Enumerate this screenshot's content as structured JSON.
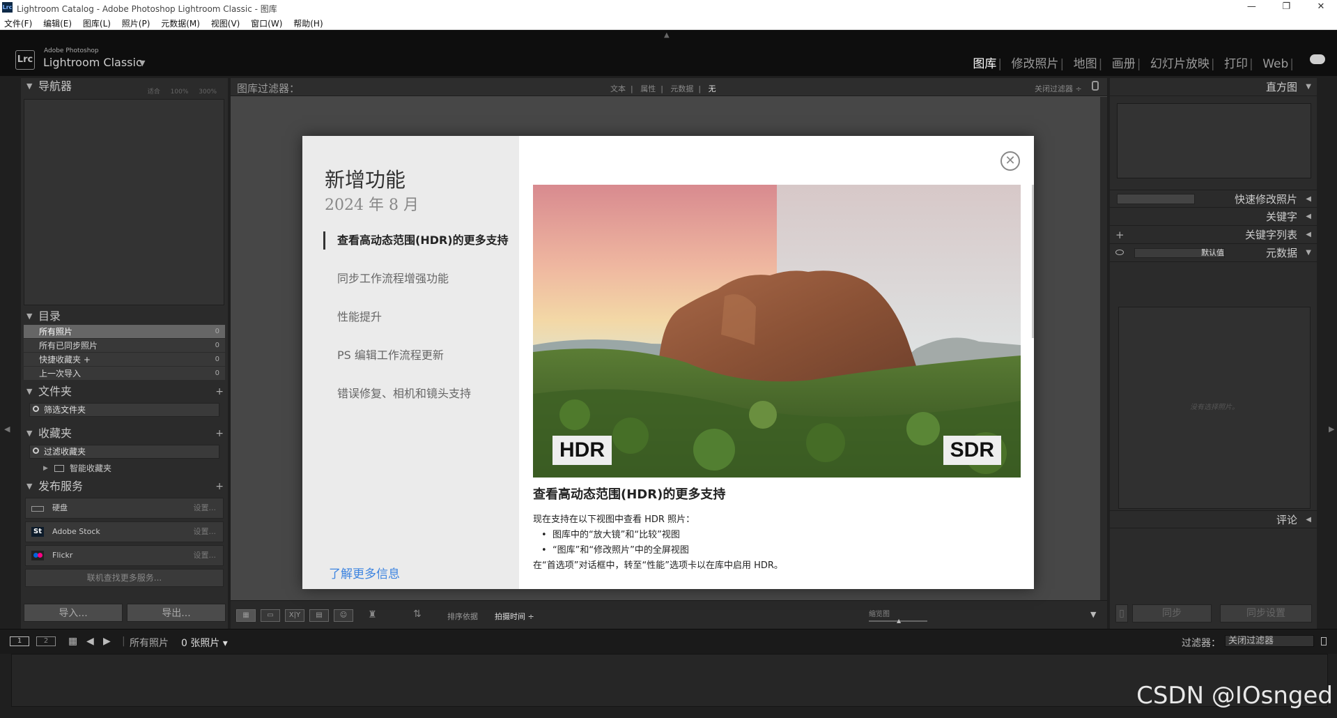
{
  "window": {
    "title": "Lightroom Catalog - Adobe Photoshop Lightroom Classic - 图库",
    "app_icon": "Lrc",
    "min_label": "—",
    "max_label": "❐",
    "close_label": "✕"
  },
  "menu": [
    "文件(F)",
    "编辑(E)",
    "图库(L)",
    "照片(P)",
    "元数据(M)",
    "视图(V)",
    "窗口(W)",
    "帮助(H)"
  ],
  "brand": {
    "line1": "Adobe Photoshop",
    "line2": "Lightroom Classic",
    "logo": "Lrc"
  },
  "modules": [
    "图库",
    "修改照片",
    "地图",
    "画册",
    "幻灯片放映",
    "打印",
    "Web"
  ],
  "left": {
    "navigator": {
      "title": "导航器",
      "options": [
        "适合",
        "100%",
        "300%"
      ]
    },
    "catalog": {
      "title": "目录",
      "rows": [
        {
          "label": "所有照片",
          "count": "0"
        },
        {
          "label": "所有已同步照片",
          "count": "0"
        },
        {
          "label": "快捷收藏夹 +",
          "count": "0"
        },
        {
          "label": "上一次导入",
          "count": "0"
        }
      ]
    },
    "folders": {
      "title": "文件夹",
      "filter_placeholder": "筛选文件夹"
    },
    "collections": {
      "title": "收藏夹",
      "filter_placeholder": "过滤收藏夹",
      "smart": "智能收藏夹"
    },
    "publish": {
      "title": "发布服务",
      "services": [
        {
          "name": "硬盘",
          "action": "设置..."
        },
        {
          "name": "Adobe Stock",
          "action": "设置..."
        },
        {
          "name": "Flickr",
          "action": "设置..."
        }
      ],
      "more": "联机查找更多服务..."
    },
    "import_label": "导入...",
    "export_label": "导出..."
  },
  "filterbar": {
    "label": "图库过滤器：",
    "options": [
      "文本",
      "属性",
      "元数据",
      "无"
    ],
    "off": "关闭过滤器 ÷"
  },
  "toolbar": {
    "sort_label": "排序依据",
    "sort_value": "拍摄时间 ÷",
    "thumb_label": "缩览图",
    "compare": "X|Y"
  },
  "right": {
    "histogram": "直方图",
    "quick_develop": "快速修改照片",
    "keywords": "关键字",
    "keyword_list": "关键字列表",
    "metadata": "元数据",
    "metadata_default": "默认值",
    "no_selection": "没有选择照片。",
    "comments": "评论",
    "sync_label": "同步",
    "sync_settings_label": "同步设置"
  },
  "filmstrip_bar": {
    "view1": "1",
    "view2": "2",
    "source": "所有照片",
    "count": "0 张照片 ▾",
    "filter_label": "过滤器：",
    "filter_value": "关闭过滤器"
  },
  "watermark": "CSDN @IOsnged",
  "modal": {
    "title": "新增功能",
    "date": "2024 年 8 月",
    "items": [
      "查看高动态范围(HDR)的更多支持",
      "同步工作流程增强功能",
      "性能提升",
      "PS 编辑工作流程更新",
      "错误修复、相机和镜头支持"
    ],
    "learn_more": "了解更多信息",
    "heading": "查看高动态范围(HDR)的更多支持",
    "desc_intro": "现在支持在以下视图中查看 HDR 照片：",
    "bullets": [
      "图库中的“放大镜”和“比较”视图",
      "“图库”和“修改照片”中的全屏视图"
    ],
    "desc_end": "在“首选项”对话框中，转至“性能”选项卡以在库中启用 HDR。",
    "badge_left": "HDR",
    "badge_right": "SDR"
  }
}
